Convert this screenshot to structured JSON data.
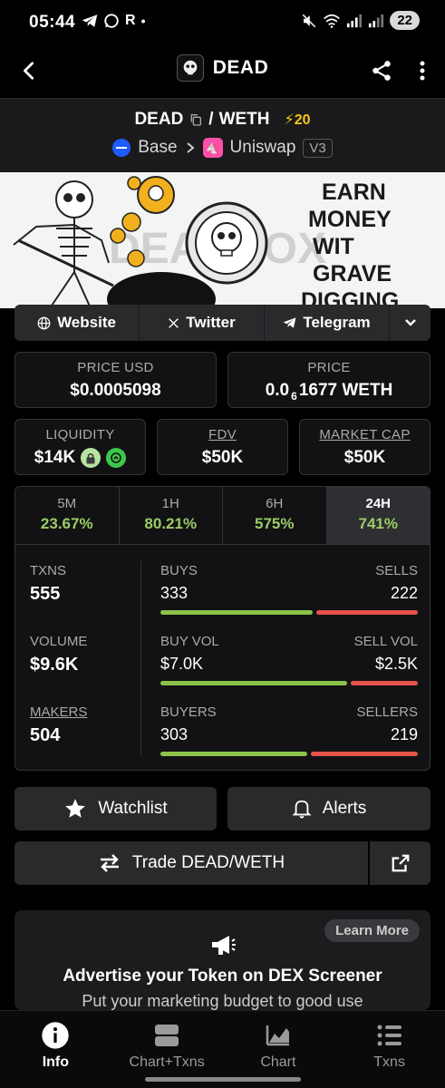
{
  "status_bar": {
    "time": "05:44",
    "left_icons": [
      "telegram-icon",
      "whatsapp-icon",
      "r-icon",
      "dot-icon"
    ],
    "r_label": "R",
    "battery": "22"
  },
  "top_bar": {
    "title": "DEAD"
  },
  "pair": {
    "base_token": "DEAD",
    "separator": "/",
    "quote_token": "WETH",
    "boost": "⚡20",
    "chain": "Base",
    "dex": "Uniswap",
    "version": "V3"
  },
  "banner": {
    "line1": "EARN",
    "line2": "MONEY",
    "line3": "WIT",
    "line4": "GRAVE",
    "line5": "DIGGING",
    "watermark": "DEADBOX"
  },
  "links": {
    "website": "Website",
    "twitter": "Twitter",
    "telegram": "Telegram"
  },
  "prices": {
    "usd_label": "PRICE USD",
    "usd_value": "$0.0005098",
    "native_label": "PRICE",
    "native_prefix": "0.0",
    "native_sub": "6",
    "native_suffix": "1677 WETH"
  },
  "metrics": {
    "liquidity_label": "LIQUIDITY",
    "liquidity_value": "$14K",
    "fdv_label": "FDV",
    "fdv_value": "$50K",
    "mcap_label": "MARKET CAP",
    "mcap_value": "$50K"
  },
  "timeframes": [
    {
      "name": "5M",
      "value": "23.67%"
    },
    {
      "name": "1H",
      "value": "80.21%"
    },
    {
      "name": "6H",
      "value": "575%"
    },
    {
      "name": "24H",
      "value": "741%"
    }
  ],
  "active_timeframe": "24H",
  "stats": {
    "txns_label": "TXNS",
    "txns_value": "555",
    "volume_label": "VOLUME",
    "volume_value": "$9.6K",
    "makers_label": "MAKERS",
    "makers_value": "504",
    "buys_label": "BUYS",
    "buys_value": "333",
    "sells_label": "SELLS",
    "sells_value": "222",
    "buys_share": 0.6,
    "buyvol_label": "BUY VOL",
    "buyvol_value": "$7.0K",
    "sellvol_label": "SELL VOL",
    "sellvol_value": "$2.5K",
    "buyvol_share": 0.737,
    "buyers_label": "BUYERS",
    "buyers_value": "303",
    "sellers_label": "SELLERS",
    "sellers_value": "219",
    "buyers_share": 0.58
  },
  "actions": {
    "watchlist": "Watchlist",
    "alerts": "Alerts",
    "trade": "Trade DEAD/WETH"
  },
  "ad": {
    "learn_more": "Learn More",
    "title": "Advertise your Token on DEX Screener",
    "subtitle": "Put your marketing budget to good use"
  },
  "bottom_nav": [
    {
      "label": "Info",
      "icon": "info-icon"
    },
    {
      "label": "Chart+Txns",
      "icon": "chart-txns-icon"
    },
    {
      "label": "Chart",
      "icon": "chart-icon"
    },
    {
      "label": "Txns",
      "icon": "list-icon"
    }
  ],
  "colors": {
    "positive": "#9ccc65",
    "buy_bar": "#8bc34a",
    "sell_bar": "#e5534b",
    "boost": "#f5c518"
  }
}
